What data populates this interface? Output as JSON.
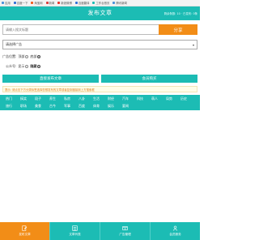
{
  "browser": {
    "bookmarks": [
      {
        "label": "应用",
        "color": "#4a90d9"
      },
      {
        "label": "百度一下",
        "color": "#2e6fd8"
      },
      {
        "label": "淘宝网",
        "color": "#f25a1d"
      },
      {
        "label": "新闻",
        "color": "#d93b3b"
      },
      {
        "label": "新浪微博",
        "color": "#e6352b"
      },
      {
        "label": "百度翻译",
        "color": "#2e6fd8"
      },
      {
        "label": "工作台首页",
        "color": "#1cbcb4"
      },
      {
        "label": "腾讯新闻",
        "color": "#4a90d9"
      }
    ]
  },
  "header": {
    "title": "发布文章",
    "info": "剩余条数: 10 · 已发布: 0条"
  },
  "search": {
    "placeholder": "请输入搜文标题",
    "button_label": "分享"
  },
  "select": {
    "value": "请选择广告",
    "arrow": "▾"
  },
  "ad_position": {
    "label": "广告位置:",
    "options": [
      {
        "label": "顶部",
        "checked": false
      },
      {
        "label": "底部",
        "checked": true
      }
    ]
  },
  "public": {
    "label": "公众号:",
    "options": [
      {
        "label": "显示",
        "checked": false
      },
      {
        "label": "隐藏",
        "checked": true
      }
    ]
  },
  "actions": {
    "publish_label": "直接发布文章",
    "buy_label": "会员购买"
  },
  "notice": "提示: 请点击下方分类标签选择您想发布的文章或者复制链接到上方搜索框",
  "categories": [
    "热门",
    "搞笑",
    "段子",
    "养生",
    "私房",
    "八卦",
    "生活",
    "财经",
    "汽车",
    "科技",
    "萌人",
    "局势",
    "历史",
    "旅行",
    "职场",
    "美食",
    "古今",
    "军事",
    "百度",
    "体育",
    "娱乐",
    "要闻"
  ],
  "tabbar": {
    "items": [
      {
        "label": "发布文章",
        "icon": "edit-icon",
        "active": true
      },
      {
        "label": "文章列表",
        "icon": "list-icon",
        "active": false
      },
      {
        "label": "广告管理",
        "icon": "ad-icon",
        "active": false
      },
      {
        "label": "会员服务",
        "icon": "user-icon",
        "active": false
      }
    ]
  },
  "colors": {
    "primary": "#1cbcb4",
    "accent": "#f28d17",
    "notice_text": "#e07c1a"
  }
}
